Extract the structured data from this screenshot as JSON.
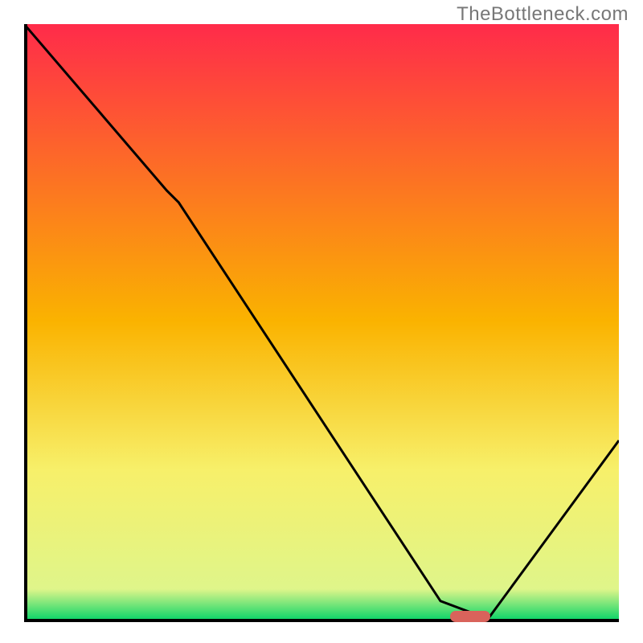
{
  "watermark": "TheBottleneck.com",
  "chart_data": {
    "type": "line",
    "title": "",
    "xlabel": "",
    "ylabel": "",
    "xlim": [
      0,
      100
    ],
    "ylim": [
      0,
      100
    ],
    "grid": false,
    "x": [
      0,
      24,
      26,
      70,
      78,
      100
    ],
    "values": [
      100,
      72,
      70,
      3,
      0,
      30
    ],
    "background_gradient": {
      "stops": [
        {
          "offset": 0,
          "color": "#ff2b4a"
        },
        {
          "offset": 50,
          "color": "#fab300"
        },
        {
          "offset": 75,
          "color": "#f7f06a"
        },
        {
          "offset": 95,
          "color": "#dff58a"
        },
        {
          "offset": 100,
          "color": "#12d66a"
        }
      ]
    },
    "marker": {
      "x": 75,
      "y": 0,
      "color": "#d9635b"
    }
  }
}
